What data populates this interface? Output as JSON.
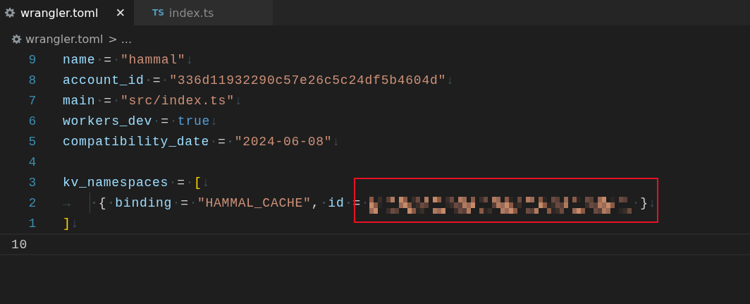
{
  "tabs": [
    {
      "label": "wrangler.toml",
      "kind": "settings-file",
      "selected": true,
      "close": "✕"
    },
    {
      "label": "index.ts",
      "kind": "typescript-file",
      "badge": "TS",
      "selected": false
    }
  ],
  "breadcrumb": {
    "file": "wrangler.toml",
    "separator": ">",
    "rest": "..."
  },
  "lines": [
    {
      "number": "9",
      "current": false,
      "tokens": [
        {
          "kind": "key",
          "t": "name"
        },
        {
          "kind": "sp"
        },
        {
          "kind": "op",
          "t": "="
        },
        {
          "kind": "sp"
        },
        {
          "kind": "string",
          "t": "\"hammal\""
        },
        {
          "kind": "eol",
          "t": "↓"
        }
      ]
    },
    {
      "number": "8",
      "current": false,
      "tokens": [
        {
          "kind": "key",
          "t": "account_id"
        },
        {
          "kind": "sp"
        },
        {
          "kind": "op",
          "t": "="
        },
        {
          "kind": "sp"
        },
        {
          "kind": "string",
          "t": "\"336d11932290c57e26c5c24df5b4604d\""
        },
        {
          "kind": "eol",
          "t": "↓"
        }
      ]
    },
    {
      "number": "7",
      "current": false,
      "tokens": [
        {
          "kind": "key",
          "t": "main"
        },
        {
          "kind": "sp"
        },
        {
          "kind": "op",
          "t": "="
        },
        {
          "kind": "sp"
        },
        {
          "kind": "string",
          "t": "\"src/index.ts\""
        },
        {
          "kind": "eol",
          "t": "↓"
        }
      ]
    },
    {
      "number": "6",
      "current": false,
      "tokens": [
        {
          "kind": "key",
          "t": "workers_dev"
        },
        {
          "kind": "sp"
        },
        {
          "kind": "op",
          "t": "="
        },
        {
          "kind": "sp"
        },
        {
          "kind": "bool",
          "t": "true"
        },
        {
          "kind": "eol",
          "t": "↓"
        }
      ]
    },
    {
      "number": "5",
      "current": false,
      "tokens": [
        {
          "kind": "key",
          "t": "compatibility_date"
        },
        {
          "kind": "sp"
        },
        {
          "kind": "op",
          "t": "="
        },
        {
          "kind": "sp"
        },
        {
          "kind": "string",
          "t": "\"2024-06-08\""
        },
        {
          "kind": "eol",
          "t": "↓"
        }
      ]
    },
    {
      "number": "4",
      "current": false
    },
    {
      "number": "3",
      "current": false,
      "tokens": [
        {
          "kind": "key",
          "t": "kv_namespaces"
        },
        {
          "kind": "sp"
        },
        {
          "kind": "op",
          "t": "="
        },
        {
          "kind": "sp"
        },
        {
          "kind": "bracket",
          "t": "["
        },
        {
          "kind": "eol",
          "t": "↓"
        }
      ]
    },
    {
      "number": "2",
      "current": false,
      "tokens": [
        {
          "kind": "tab",
          "t": "→"
        },
        {
          "kind": "guide"
        },
        {
          "kind": "sp"
        },
        {
          "kind": "brace",
          "t": "{"
        },
        {
          "kind": "sp"
        },
        {
          "kind": "key",
          "t": "binding"
        },
        {
          "kind": "sp"
        },
        {
          "kind": "op",
          "t": "="
        },
        {
          "kind": "sp"
        },
        {
          "kind": "string",
          "t": "\"HAMMAL_CACHE\""
        },
        {
          "kind": "op",
          "t": ","
        },
        {
          "kind": "sp"
        },
        {
          "kind": "key",
          "t": "id"
        },
        {
          "kind": "sp"
        },
        {
          "kind": "op",
          "t": "="
        },
        {
          "kind": "sp"
        },
        {
          "kind": "redacted",
          "highlighted": true
        },
        {
          "kind": "sp"
        },
        {
          "kind": "brace",
          "t": "}"
        },
        {
          "kind": "eol",
          "t": "↓"
        }
      ]
    },
    {
      "number": "1",
      "current": false,
      "tokens": [
        {
          "kind": "bracket",
          "t": "]"
        },
        {
          "kind": "eol",
          "t": "↓"
        }
      ]
    },
    {
      "number": "10",
      "current": true
    }
  ]
}
